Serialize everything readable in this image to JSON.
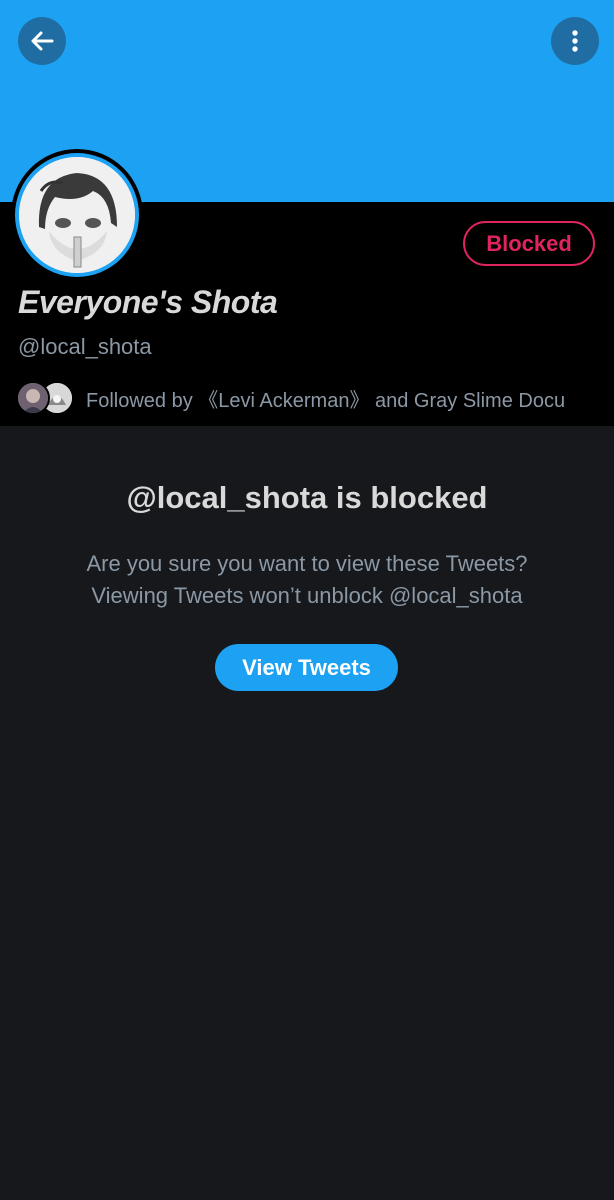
{
  "header": {
    "back_icon": "arrow-left-icon",
    "more_icon": "more-vertical-icon",
    "banner_color": "#1da1f2"
  },
  "profile": {
    "display_name": "Everyone's Shota",
    "handle": "@local_shota",
    "blocked_label": "Blocked",
    "followed_by_text": "Followed by 《Levi Ackerman》 and Gray Slime Docu"
  },
  "blocked_notice": {
    "title": "@local_shota is blocked",
    "line1": "Are you sure you want to view these Tweets?",
    "line2": "Viewing Tweets won’t unblock @local_shota",
    "button_label": "View Tweets"
  },
  "colors": {
    "accent": "#1da1f2",
    "blocked": "#e0245e",
    "background": "#16181c",
    "profile_bg": "#000000"
  }
}
